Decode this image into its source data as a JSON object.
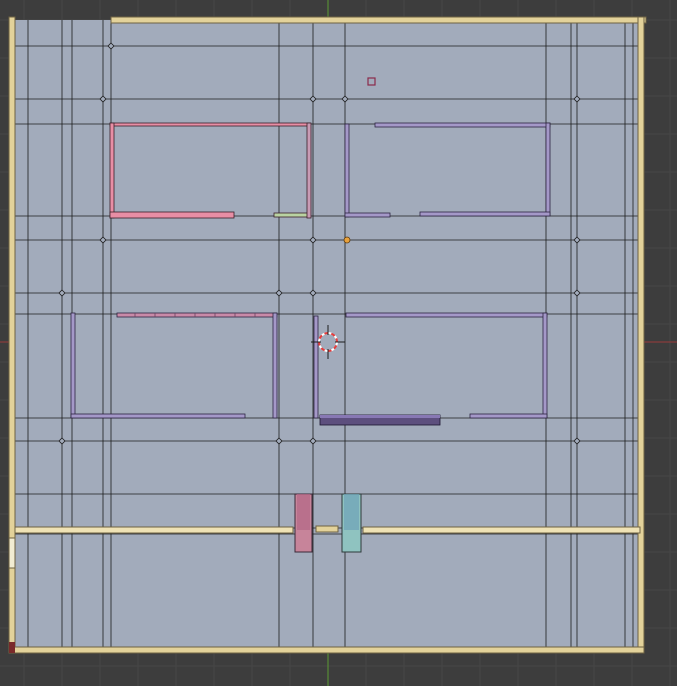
{
  "viewport": {
    "label": "",
    "view": "top-orthographic",
    "mode": "edit-mode-wireframe"
  },
  "colors": {
    "background": "#3d3d3d",
    "grid_minor": "#474747",
    "floor_face": "#a2abbb",
    "edge": "#1c1c1c",
    "outer_wall": "#e3d29a",
    "outer_wall_dark": "#6e6243",
    "wall_pink": "#e88ea5",
    "wall_purple": "#a498c8",
    "wall_purple_dark": "#5d4f7e",
    "wall_green": "#b9d3a2",
    "door_pink": "#c7849a",
    "door_teal": "#8fc3c0",
    "axis_red": "#9b3a3a",
    "axis_green": "#5c9a33",
    "object_origin": "#e8a13c",
    "cursor_red": "#e63c3c"
  },
  "objects": {
    "origin_dot": "object-origin",
    "cursor": "3d-cursor",
    "lamp_marker": "lamp-marker"
  }
}
